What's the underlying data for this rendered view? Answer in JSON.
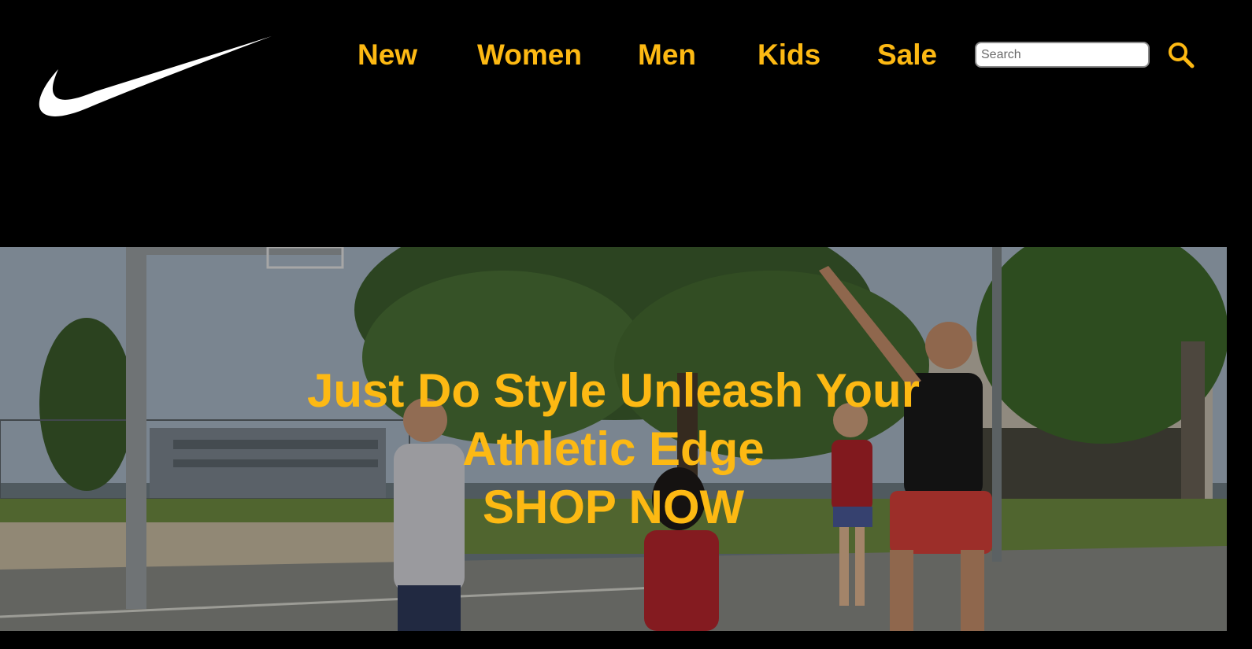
{
  "brand": {
    "logo_icon": "swoosh-logo-icon",
    "accent_color": "#FDB913",
    "background_color": "#000000"
  },
  "nav": {
    "items": [
      {
        "label": "New"
      },
      {
        "label": "Women"
      },
      {
        "label": "Men"
      },
      {
        "label": "Kids"
      },
      {
        "label": "Sale"
      }
    ]
  },
  "search": {
    "placeholder": "Search",
    "value": "",
    "icon": "search-icon"
  },
  "hero": {
    "headline": "Just Do Style Unleash Your Athletic Edge",
    "cta_label": "SHOP NOW",
    "image_description_icon": "basketball-court-photo"
  }
}
